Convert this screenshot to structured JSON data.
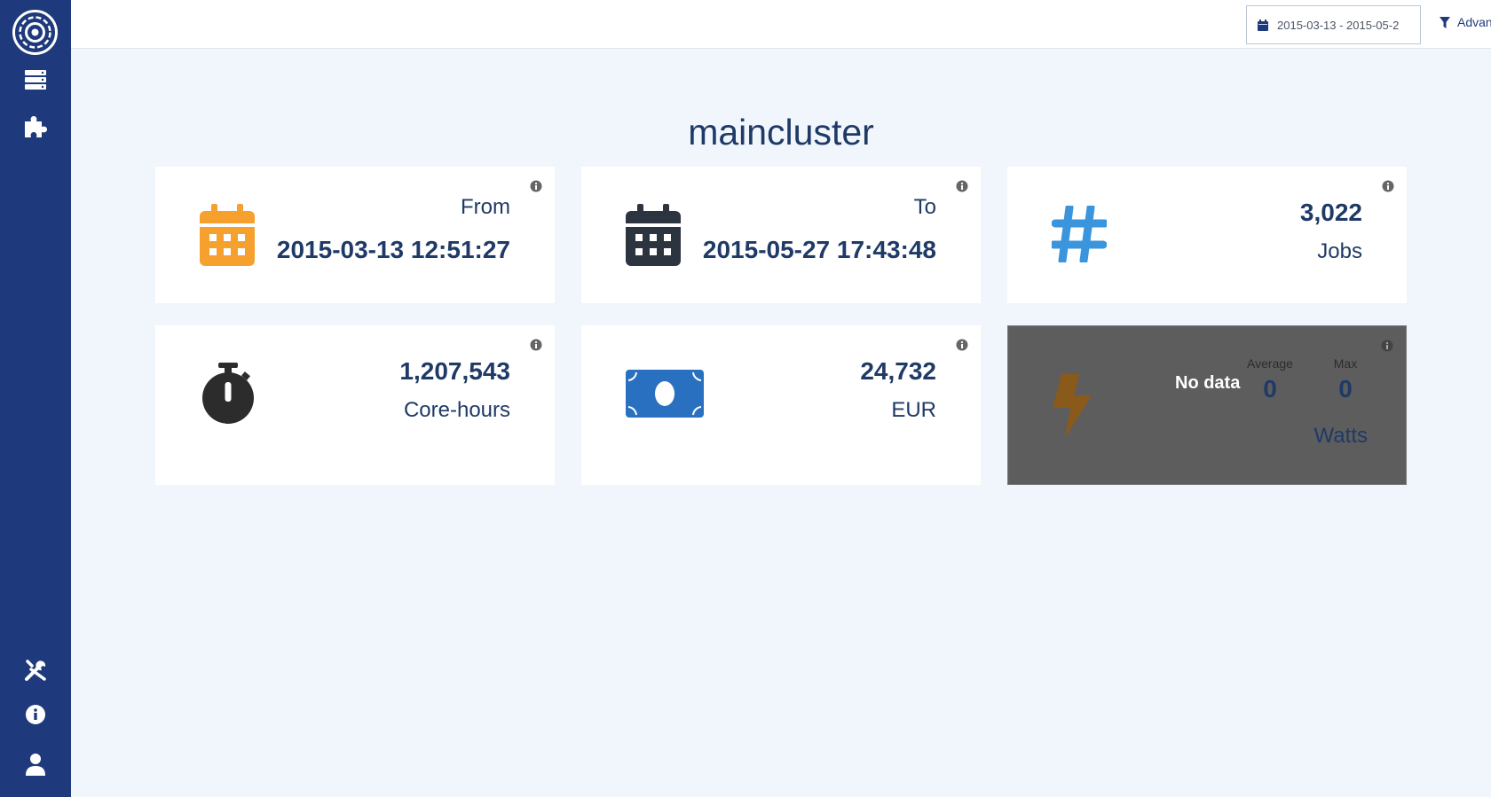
{
  "topbar": {
    "date_range": "2015-03-13 - 2015-05-2",
    "advanced_label": "Advanced"
  },
  "page": {
    "title": "maincluster"
  },
  "cards": {
    "from": {
      "label": "From",
      "value": "2015-03-13 12:51:27",
      "icon": "calendar-icon",
      "color": "#f6a02d"
    },
    "to": {
      "label": "To",
      "value": "2015-05-27 17:43:48",
      "icon": "calendar-icon",
      "color": "#2c3440"
    },
    "jobs": {
      "value": "3,022",
      "label": "Jobs",
      "icon": "hashtag-icon",
      "color": "#3a95dc"
    },
    "corehours": {
      "value": "1,207,543",
      "label": "Core-hours",
      "icon": "stopwatch-icon",
      "color": "#2c2c2c"
    },
    "cost": {
      "value": "24,732",
      "label": "EUR",
      "icon": "money-bill-icon",
      "color": "#2a70c0"
    },
    "power": {
      "status": "No data",
      "average_label": "Average",
      "average_value": "0",
      "max_label": "Max",
      "max_value": "0",
      "unit": "Watts",
      "icon": "bolt-icon",
      "color": "#8a5a1a"
    }
  },
  "sidebar": {
    "top_icons": [
      "logo-icon",
      "server-icon",
      "puzzle-icon"
    ],
    "bottom_icons": [
      "tools-icon",
      "info-icon",
      "user-icon"
    ]
  }
}
